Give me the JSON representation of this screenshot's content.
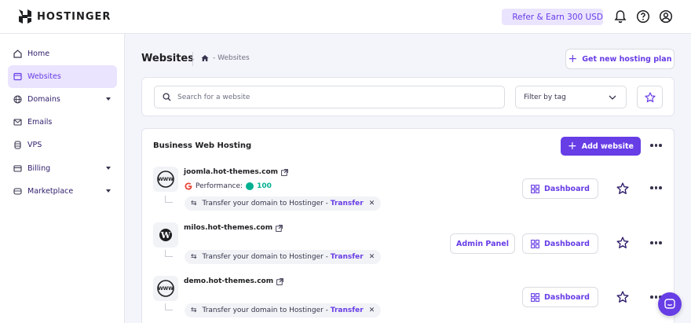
{
  "header": {
    "logo_text": "HOSTINGER",
    "refer_label": "Refer & Earn 300 USD",
    "icons": [
      "bell-icon",
      "help-icon",
      "account-icon"
    ]
  },
  "sidebar": {
    "items": [
      {
        "label": "Home",
        "icon": "home-icon",
        "active": false
      },
      {
        "label": "Websites",
        "icon": "websites-icon",
        "active": true
      },
      {
        "label": "Domains",
        "icon": "globe-icon",
        "active": false,
        "expandable": true
      },
      {
        "label": "Emails",
        "icon": "mail-icon",
        "active": false
      },
      {
        "label": "VPS",
        "icon": "server-icon",
        "active": false
      },
      {
        "label": "Billing",
        "icon": "card-icon",
        "active": false,
        "expandable": true
      },
      {
        "label": "Marketplace",
        "icon": "store-icon",
        "active": false,
        "expandable": true
      }
    ]
  },
  "page": {
    "title": "Websites",
    "breadcrumb": "- Websites",
    "new_plan_label": "Get new hosting plan"
  },
  "search": {
    "placeholder": "Search for a website",
    "filter_label": "Filter by tag"
  },
  "list": {
    "title": "Business Web Hosting",
    "add_website_label": "Add website",
    "transfer_text": "Transfer your domain to Hostinger -",
    "transfer_link": "Transfer",
    "dashboard_label": "Dashboard",
    "admin_panel_label": "Admin Panel",
    "sites": [
      {
        "domain": "joomla.hot-themes.com",
        "icon": "www-icon",
        "performance_label": "Performance:",
        "performance_score": "100"
      },
      {
        "domain": "milos.hot-themes.com",
        "icon": "wordpress-icon",
        "has_admin_panel": true
      },
      {
        "domain": "demo.hot-themes.com",
        "icon": "www-icon"
      }
    ]
  },
  "colors": {
    "accent": "#673de6",
    "accent_light": "#ebe4ff",
    "performance": "#00b090"
  }
}
